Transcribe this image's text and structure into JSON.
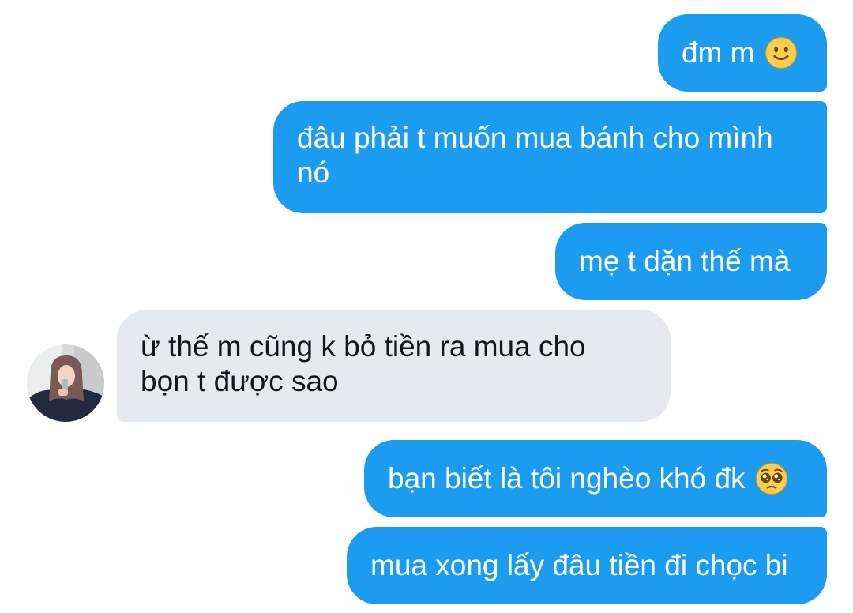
{
  "conversation": {
    "messages": [
      {
        "sender": "me",
        "text": "đm m",
        "emoji": "slightly-smiling-face"
      },
      {
        "sender": "me",
        "text": "đâu phải t muốn mua bánh cho mình nó"
      },
      {
        "sender": "me",
        "text": "mẹ t dặn thế mà"
      },
      {
        "sender": "them",
        "text": "ừ thế m cũng k bỏ tiền ra mua cho bọn t được sao"
      },
      {
        "sender": "me",
        "text": "bạn biết là tôi nghèo khó đk",
        "emoji": "pleading-face"
      },
      {
        "sender": "me",
        "text": "mua xong lấy đâu tiền đi chọc bi"
      }
    ]
  },
  "colors": {
    "outgoing_bubble": "#1c9cf0",
    "incoming_bubble": "#e6e9ed",
    "outgoing_text": "#ffffff",
    "incoming_text": "#14171a"
  }
}
